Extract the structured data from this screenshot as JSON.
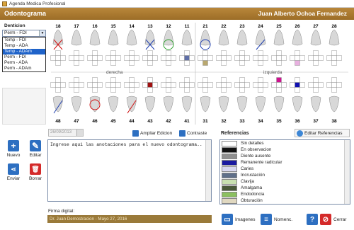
{
  "window": {
    "title": "Agenda Medica Profesional"
  },
  "header": {
    "title": "Odontograma",
    "patient": "Juan Alberto Ochoa Fernandez"
  },
  "denticion": {
    "label": "Denticion",
    "selected": "Perm - FDI",
    "options": [
      "Temp - FDI",
      "Temp - ADA",
      "Temp - ADAm",
      "Perm - FDI",
      "Perm - ADA",
      "Perm - ADAm"
    ],
    "highlighted_option": "Temp - ADAm"
  },
  "actions": {
    "nuevo": "Nuevo",
    "editar": "Editar",
    "enviar": "Enviar",
    "borrar": "Borrar"
  },
  "chart": {
    "upper_numbers": [
      "18",
      "17",
      "16",
      "15",
      "14",
      "13",
      "12",
      "11",
      "21",
      "22",
      "23",
      "24",
      "25",
      "26",
      "27",
      "28"
    ],
    "lower_numbers": [
      "48",
      "47",
      "46",
      "45",
      "44",
      "43",
      "42",
      "41",
      "31",
      "32",
      "33",
      "34",
      "35",
      "36",
      "37",
      "38"
    ],
    "label_right": "derecha",
    "label_left": "izquierda"
  },
  "toolbar": {
    "date": "26/09/2013",
    "ampliar": "Ampliar Edicion",
    "contraste": "Contraste"
  },
  "notes": {
    "text": "Ingrese aqui las anotaciones para el nuevo odontograma.."
  },
  "firma": {
    "label": "Firma digital:",
    "value": "Dr. Juan Demostracion - Mayo 27, 2016"
  },
  "referencias": {
    "title": "Referencias",
    "edit_button": "Editar Referencias",
    "items": [
      {
        "label": "Sin detalles",
        "color": "#ffffff"
      },
      {
        "label": "En observacion",
        "color": "#111111"
      },
      {
        "label": "Diente ausente",
        "color": "#8f8f8f"
      },
      {
        "label": "Remanente radicular",
        "color": "#1a1aa0"
      },
      {
        "label": "Caries",
        "color": "#d8d8f0"
      },
      {
        "label": "Incrustación",
        "color": "#60708a"
      },
      {
        "label": "Clavija",
        "color": "#c8e0b0"
      },
      {
        "label": "Amalgama",
        "color": "#4a5a3a"
      },
      {
        "label": "Endodoncia",
        "color": "#8bc060"
      },
      {
        "label": "Obturación",
        "color": "#e0d8c0"
      }
    ]
  },
  "bottom": {
    "imagenes": "Imagenes",
    "nomenc": "Nomenc.",
    "cerrar": "Cerrar"
  }
}
